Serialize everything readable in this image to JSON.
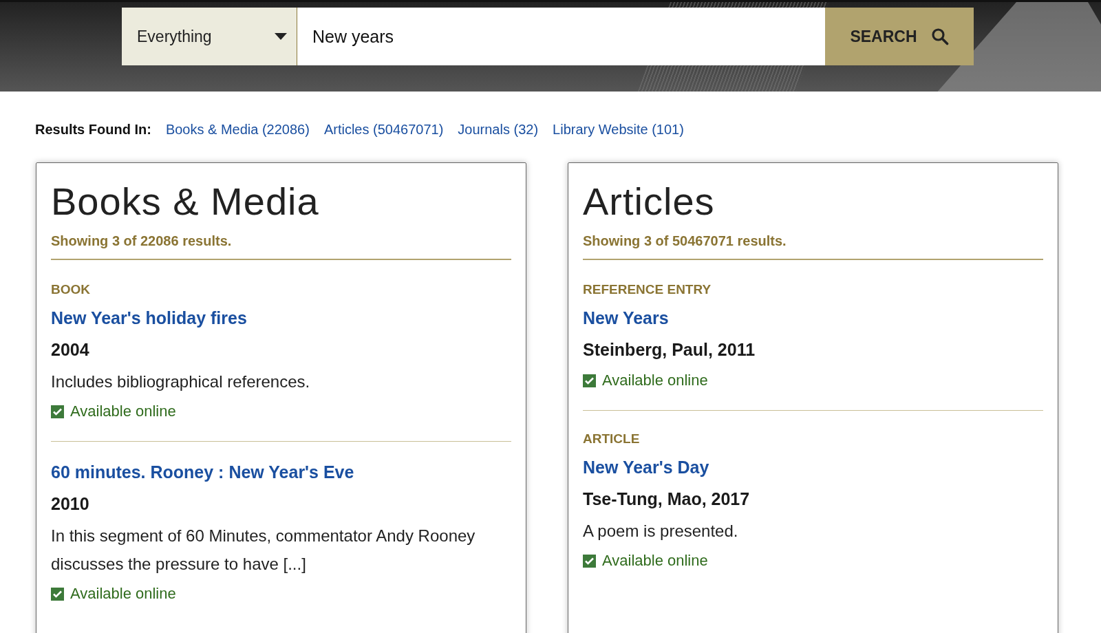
{
  "search": {
    "scope": "Everything",
    "query": "New years",
    "button": "SEARCH"
  },
  "results_found": {
    "label": "Results Found In:",
    "links": [
      "Books & Media (22086)",
      "Articles (50467071)",
      "Journals (32)",
      "Library Website (101)"
    ]
  },
  "panels": [
    {
      "title": "Books & Media",
      "summary": "Showing 3 of 22086 results.",
      "items": [
        {
          "type": "BOOK",
          "title": "New Year's holiday fires",
          "byline": "2004",
          "description": "Includes bibliographical references.",
          "available": true,
          "availability": "Available online"
        },
        {
          "title": "60 minutes. Rooney : New Year's Eve",
          "byline": "2010",
          "description": "In this segment of 60 Minutes, commentator Andy Rooney discusses the pressure to have [...]",
          "available": true,
          "availability": "Available online"
        }
      ]
    },
    {
      "title": "Articles",
      "summary": "Showing 3 of 50467071 results.",
      "items": [
        {
          "type": "REFERENCE ENTRY",
          "title": "New Years",
          "byline": "Steinberg, Paul, 2011",
          "available": true,
          "availability": "Available online"
        },
        {
          "type": "ARTICLE",
          "title": "New Year's Day",
          "byline": "Tse-Tung, Mao, 2017",
          "description": "A poem is presented.",
          "available": true,
          "availability": "Available online"
        }
      ]
    }
  ]
}
